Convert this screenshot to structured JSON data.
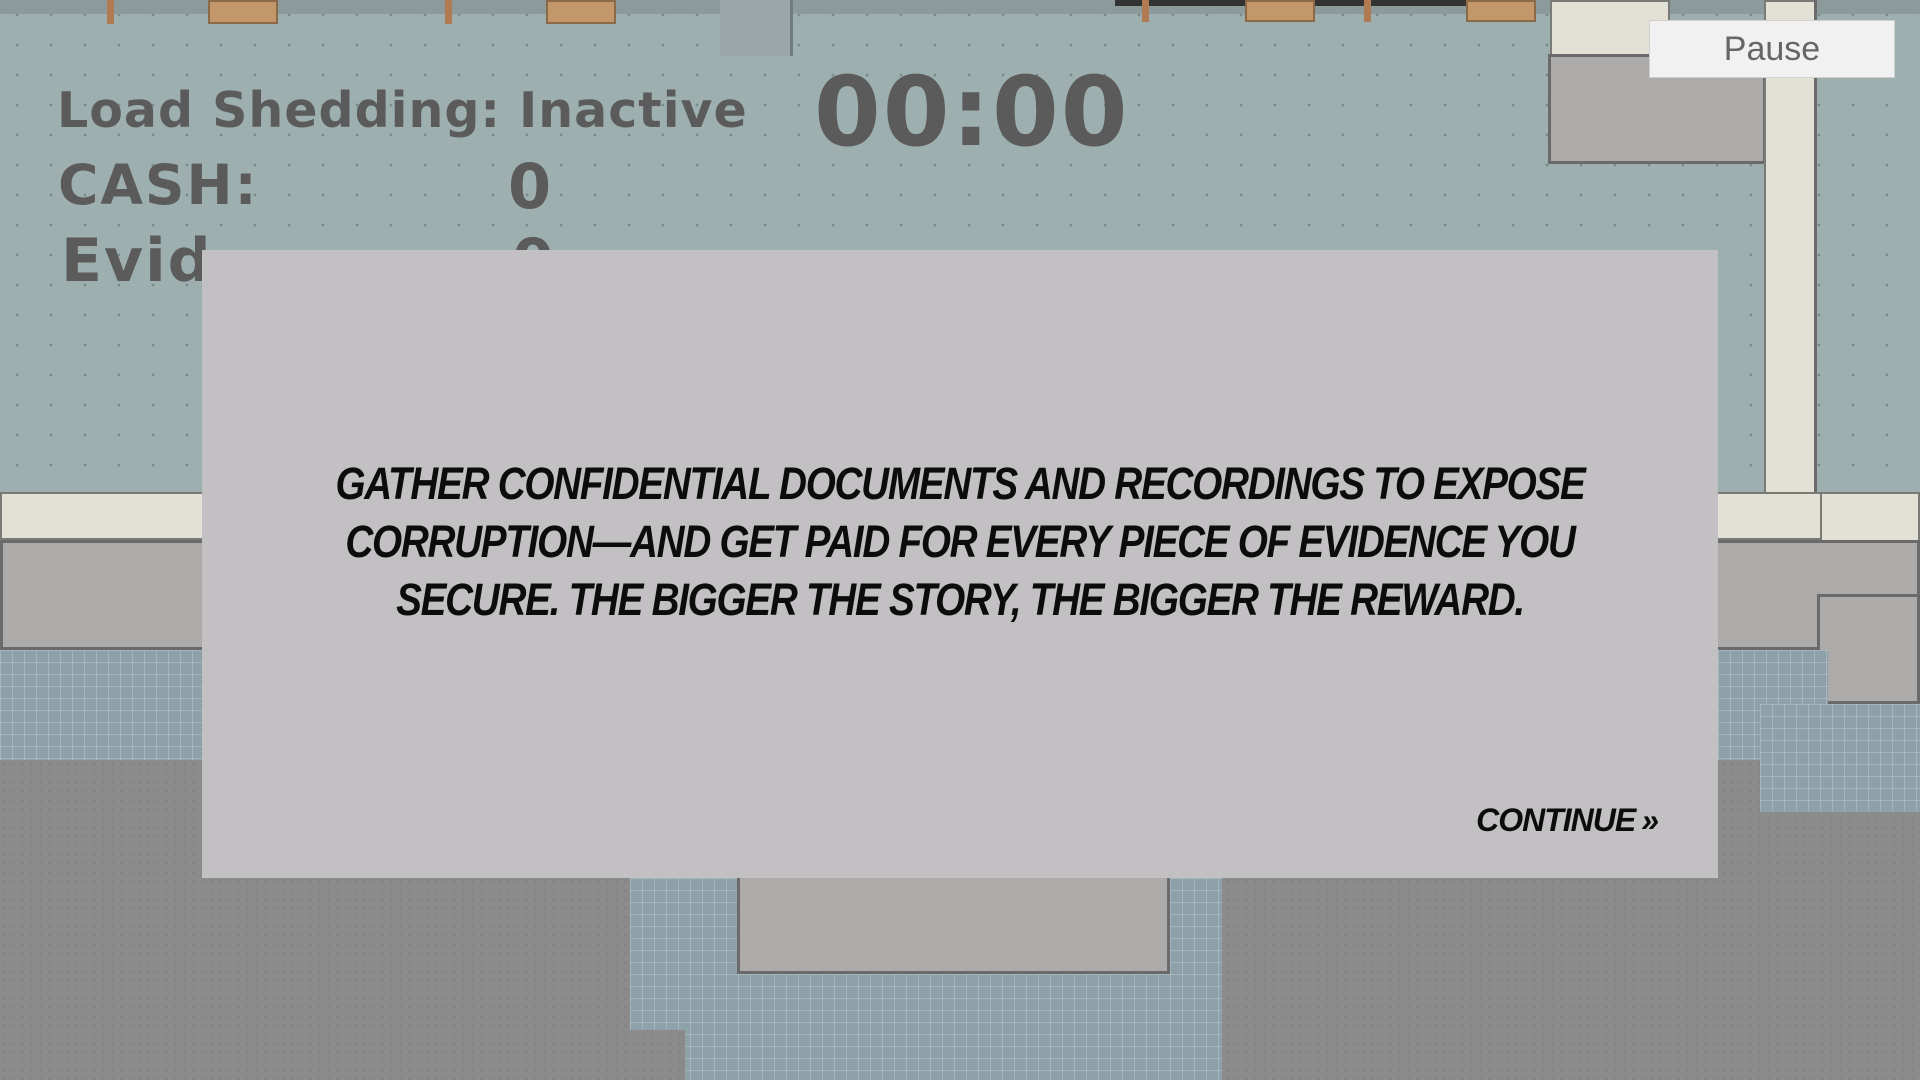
{
  "hud": {
    "load_shedding_label": "Load Shedding: Inactive",
    "timer": "00:00",
    "cash_label": "CASH:",
    "cash_value": "0",
    "evidence_label_visible": "Evid",
    "evidence_value": "0"
  },
  "pause_button": {
    "label": "Pause"
  },
  "dialog": {
    "message": "GATHER CONFIDENTIAL DOCUMENTS AND RECORDINGS TO EXPOSE CORRUPTION—AND GET PAID FOR EVERY PIECE OF EVIDENCE YOU SECURE. THE BIGGER THE STORY, THE BIGGER THE REWARD.",
    "continue_label": "CONTINUE",
    "continue_icon": "double-chevron-right-icon"
  },
  "colors": {
    "teal_floor": "#9eafb0",
    "gray_floor": "#8b8b8b",
    "dialog_bg": "#c2c0c2",
    "hud_text": "#5b5b5b"
  }
}
